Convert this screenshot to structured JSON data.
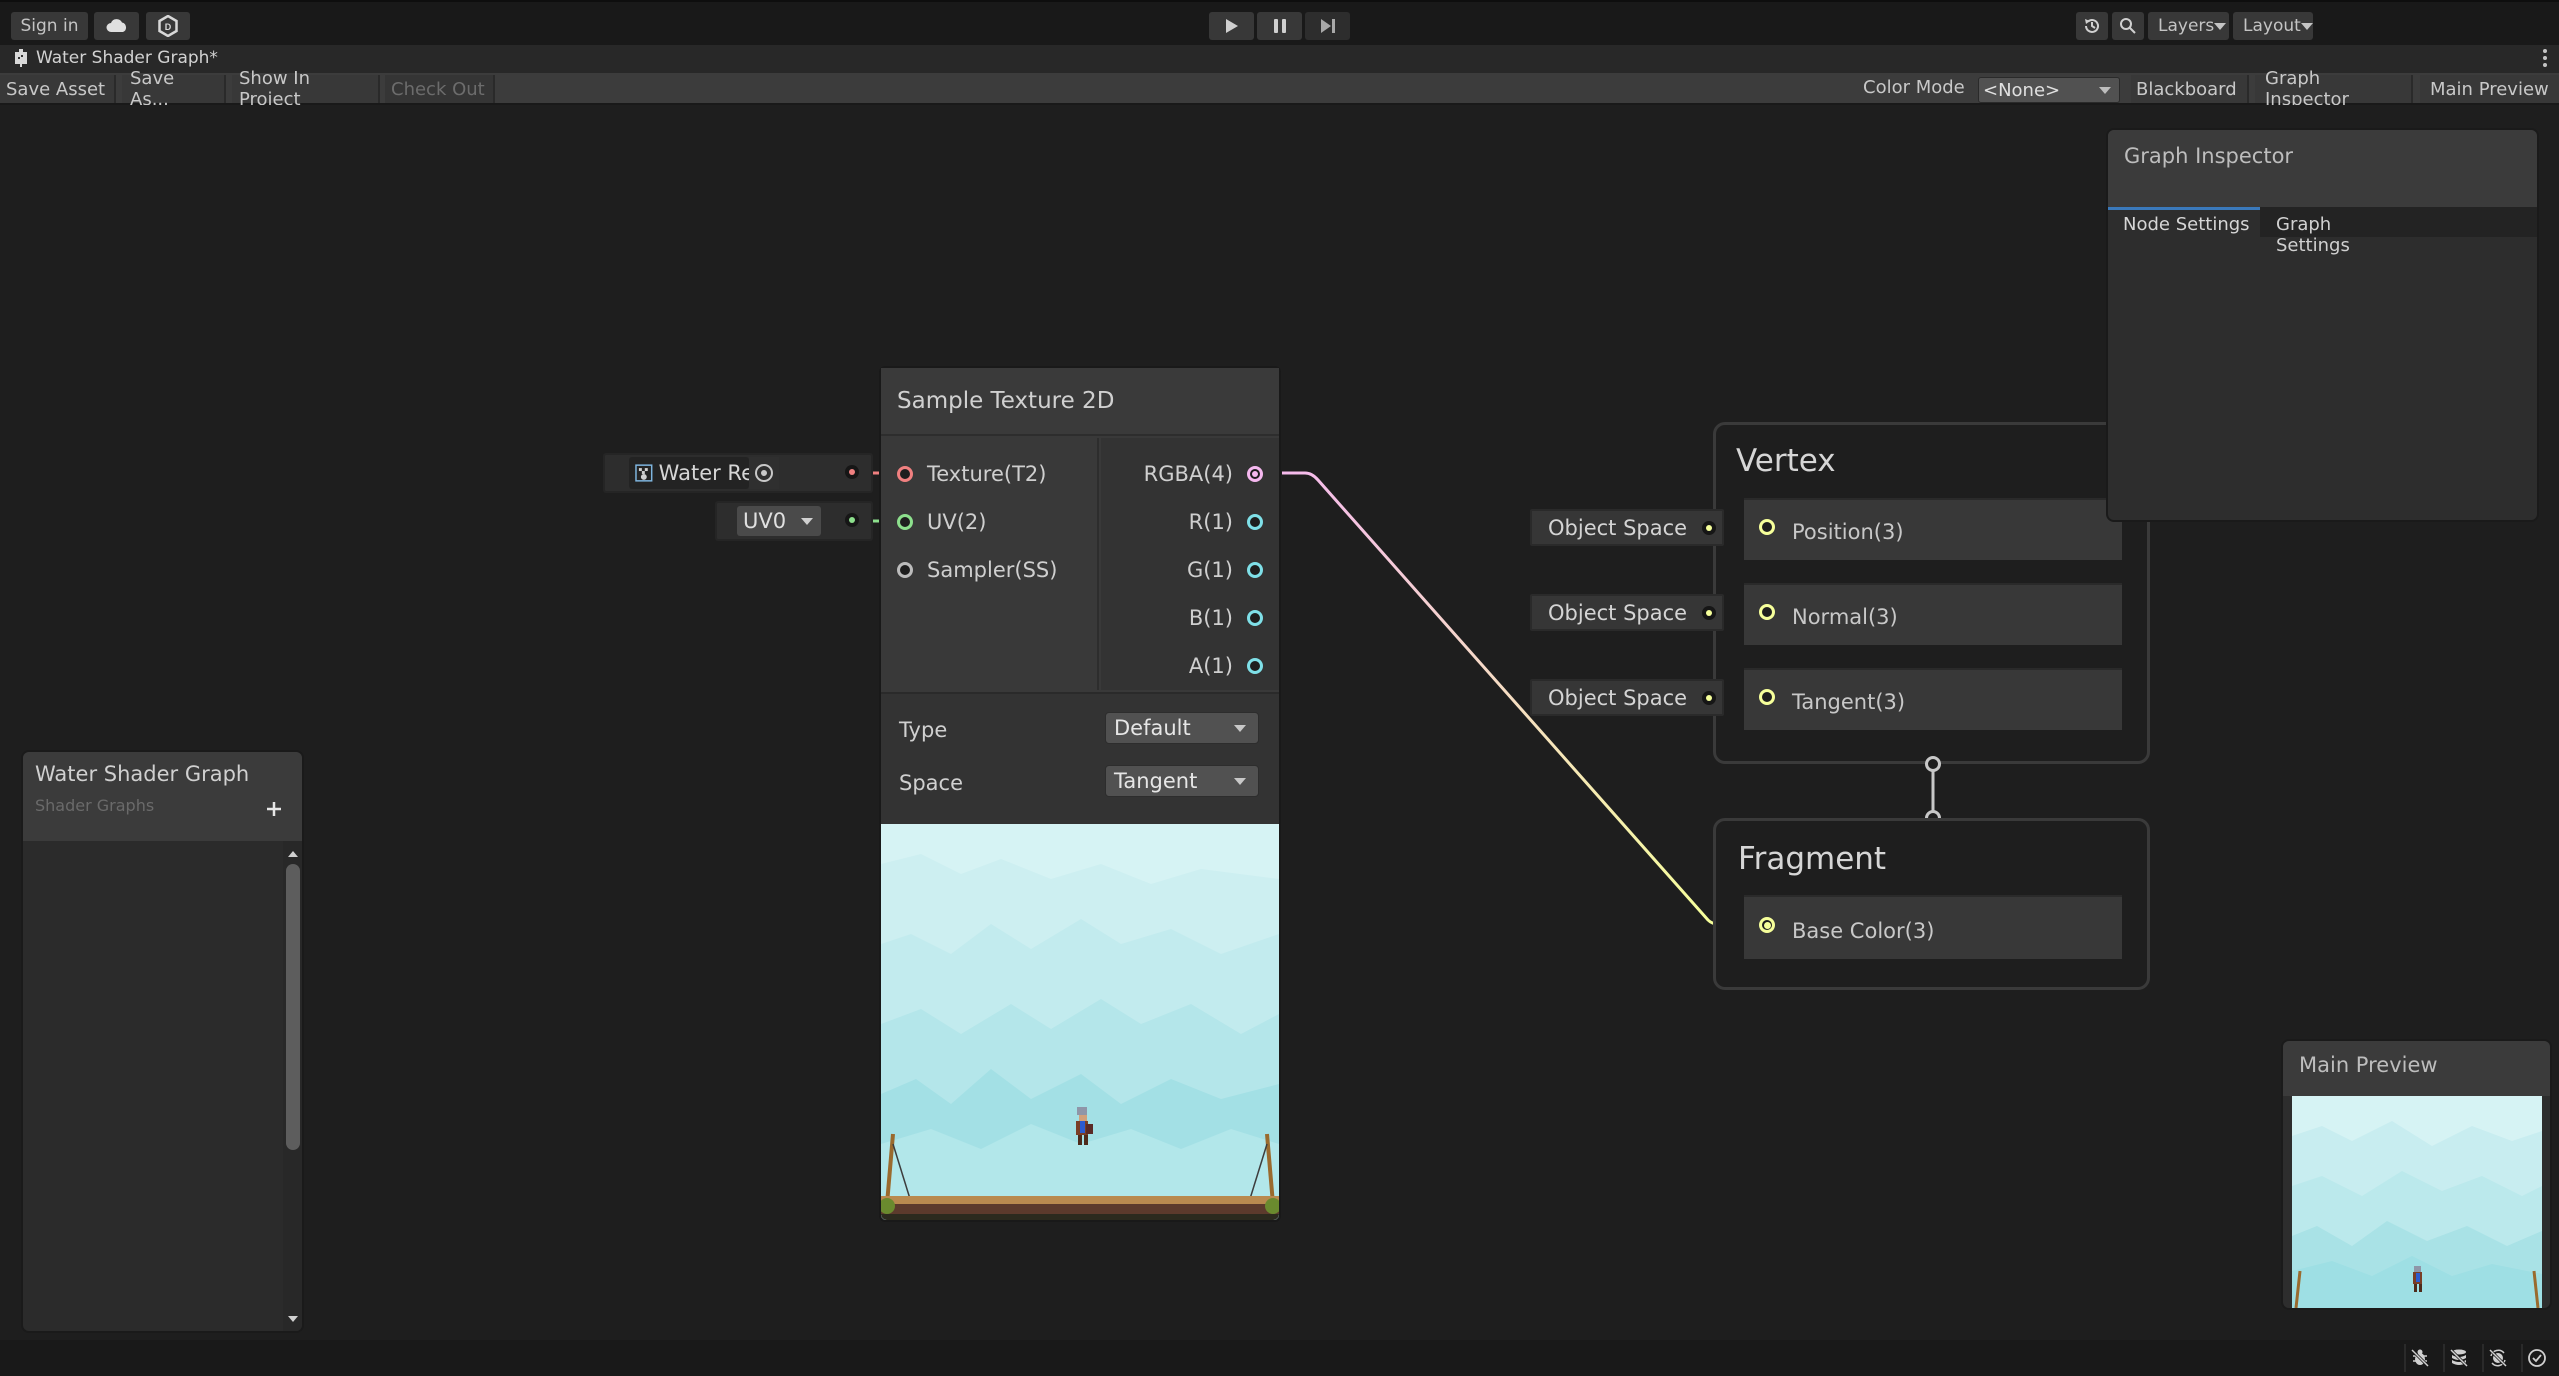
{
  "app_toolbar": {
    "sign_in": "Sign in",
    "cloud_icon": "cloud-icon",
    "services_icon": "unity-services-icon",
    "play_icon": "play-icon",
    "pause_icon": "pause-icon",
    "step_icon": "step-icon",
    "history_icon": "history-icon",
    "search_icon": "search-icon",
    "layers_label": "Layers",
    "layout_label": "Layout"
  },
  "window": {
    "title": "Water Shader Graph*",
    "icon": "shader-graph-icon"
  },
  "graph_toolbar": {
    "save_asset": "Save Asset",
    "save_as": "Save As...",
    "show_in_project": "Show In Project",
    "check_out": "Check Out",
    "color_mode_label": "Color Mode",
    "color_mode_value": "<None>",
    "blackboard": "Blackboard",
    "graph_inspector": "Graph Inspector",
    "main_preview": "Main Preview"
  },
  "blackboard": {
    "title": "Water Shader Graph",
    "subtitle": "Shader Graphs",
    "add_icon": "plus-icon"
  },
  "property_inputs": {
    "texture_name": "Water Rende",
    "uv_value": "UV0"
  },
  "sample_node": {
    "title": "Sample Texture 2D",
    "inputs": [
      {
        "label": "Texture(T2)",
        "color": "#f08080"
      },
      {
        "label": "UV(2)",
        "color": "#8de08d"
      },
      {
        "label": "Sampler(SS)",
        "color": "#bcbcbc"
      }
    ],
    "outputs": [
      {
        "label": "RGBA(4)",
        "color": "#f5b8ef"
      },
      {
        "label": "R(1)",
        "color": "#7fe0e8"
      },
      {
        "label": "G(1)",
        "color": "#7fe0e8"
      },
      {
        "label": "B(1)",
        "color": "#7fe0e8"
      },
      {
        "label": "A(1)",
        "color": "#7fe0e8"
      }
    ],
    "type_label": "Type",
    "type_value": "Default",
    "space_label": "Space",
    "space_value": "Tangent"
  },
  "vertex": {
    "title": "Vertex",
    "blocks": [
      {
        "label": "Position(3)",
        "default": "Object Space"
      },
      {
        "label": "Normal(3)",
        "default": "Object Space"
      },
      {
        "label": "Tangent(3)",
        "default": "Object Space"
      }
    ]
  },
  "fragment": {
    "title": "Fragment",
    "blocks": [
      {
        "label": "Base Color(3)"
      }
    ]
  },
  "graph_inspector": {
    "title": "Graph Inspector",
    "tabs": [
      {
        "label": "Node Settings",
        "active": true
      },
      {
        "label": "Graph Settings",
        "active": false
      }
    ]
  },
  "main_preview": {
    "title": "Main Preview"
  },
  "status_bar": {
    "icons": [
      "debug-off-icon",
      "cache-off-icon",
      "auto-gen-off-icon",
      "check-icon"
    ]
  },
  "colors": {
    "accent_tab": "#3a79bb",
    "vector3_port": "#f6ff9a",
    "texture_port": "#f08080",
    "vector2_port": "#8de08d",
    "vector4_port": "#f5b8ef",
    "float_port": "#7fe0e8"
  }
}
